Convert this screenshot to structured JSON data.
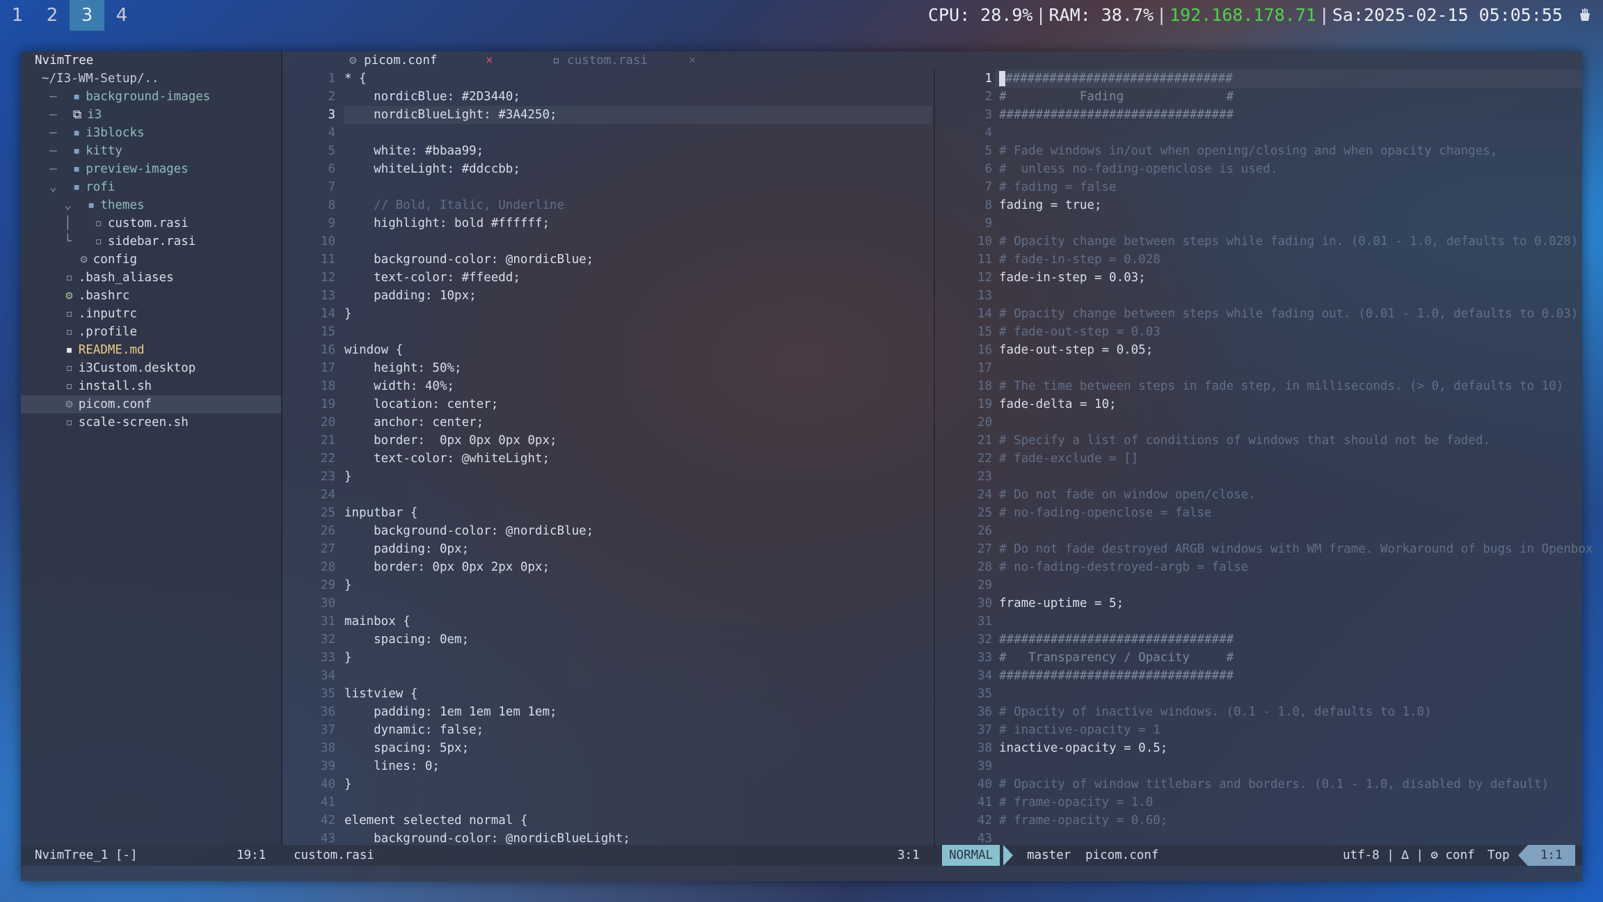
{
  "workspaces": [
    {
      "label": "1",
      "active": false
    },
    {
      "label": "2",
      "active": false
    },
    {
      "label": "3",
      "active": true
    },
    {
      "label": "4",
      "active": false
    }
  ],
  "status": {
    "cpu": "CPU: 28.9%",
    "ram": "RAM: 38.7%",
    "ip": "192.168.178.71",
    "datetime": "Sa:2025-02-15 05:05:55",
    "ip_color": "#4fd24a"
  },
  "tree": {
    "title": "NvimTree",
    "root": "~/I3-WM-Setup/..",
    "items": [
      {
        "prefix": "  –  ",
        "icon": "folder-icon",
        "name": "background-images",
        "kind": "dir"
      },
      {
        "prefix": "  –  ",
        "icon": "i3-icon",
        "name": "i3",
        "kind": "dir"
      },
      {
        "prefix": "  –  ",
        "icon": "folder-icon",
        "name": "i3blocks",
        "kind": "dir"
      },
      {
        "prefix": "  –  ",
        "icon": "folder-icon",
        "name": "kitty",
        "kind": "dir"
      },
      {
        "prefix": "  –  ",
        "icon": "folder-icon",
        "name": "preview-images",
        "kind": "dir"
      },
      {
        "prefix": "  ⌄  ",
        "icon": "folder-open-icon",
        "name": "rofi",
        "kind": "dir"
      },
      {
        "prefix": "    ⌄  ",
        "icon": "folder-open-icon",
        "name": "themes",
        "kind": "dir"
      },
      {
        "prefix": "    │   ",
        "icon": "file-icon",
        "name": "custom.rasi",
        "kind": "file"
      },
      {
        "prefix": "    └   ",
        "icon": "file-icon",
        "name": "sidebar.rasi",
        "kind": "file"
      },
      {
        "prefix": "      ",
        "icon": "gear-icon",
        "name": "config",
        "kind": "file"
      },
      {
        "prefix": "    ",
        "icon": "file-icon",
        "name": ".bash_aliases",
        "kind": "file"
      },
      {
        "prefix": "    ",
        "icon": "gear-icon",
        "name": ".bashrc",
        "kind": "file"
      },
      {
        "prefix": "    ",
        "icon": "file-icon",
        "name": ".inputrc",
        "kind": "file"
      },
      {
        "prefix": "    ",
        "icon": "file-icon",
        "name": ".profile",
        "kind": "file"
      },
      {
        "prefix": "    ",
        "icon": "markdown-icon",
        "name": "README.md",
        "kind": "md"
      },
      {
        "prefix": "    ",
        "icon": "desktop-icon",
        "name": "i3Custom.desktop",
        "kind": "file"
      },
      {
        "prefix": "    ",
        "icon": "shell-icon",
        "name": "install.sh",
        "kind": "file"
      },
      {
        "prefix": "    ",
        "icon": "gear-icon",
        "name": "picom.conf",
        "kind": "file",
        "selected": true
      },
      {
        "prefix": "    ",
        "icon": "shell-icon",
        "name": "scale-screen.sh",
        "kind": "file"
      }
    ]
  },
  "tabs": [
    {
      "icon": "gear-icon",
      "label": "picom.conf",
      "close": "×",
      "active": true
    },
    {
      "icon": "file-icon",
      "label": "custom.rasi",
      "close": "×",
      "active": false
    }
  ],
  "left_editor": {
    "current_line": 3,
    "lines": [
      "* {",
      "    nordicBlue: #2D3440;",
      "    nordicBlueLight: #3A4250;",
      "",
      "    white: #bbaa99;",
      "    whiteLight: #ddccbb;",
      "",
      "    // Bold, Italic, Underline",
      "    highlight: bold #ffffff;",
      "",
      "    background-color: @nordicBlue;",
      "    text-color: #ffeedd;",
      "    padding: 10px;",
      "}",
      "",
      "window {",
      "    height: 50%;",
      "    width: 40%;",
      "    location: center;",
      "    anchor: center;",
      "    border:  0px 0px 0px 0px;",
      "    text-color: @whiteLight;",
      "}",
      "",
      "inputbar {",
      "    background-color: @nordicBlue;",
      "    padding: 0px;",
      "    border: 0px 0px 2px 0px;",
      "}",
      "",
      "mainbox {",
      "    spacing: 0em;",
      "}",
      "",
      "listview {",
      "    padding: 1em 1em 1em 1em;",
      "    dynamic: false;",
      "    spacing: 5px;",
      "    lines: 0;",
      "}",
      "",
      "element selected normal {",
      "    background-color: @nordicBlueLight;"
    ]
  },
  "right_editor": {
    "current_line": 1,
    "lines": [
      "################################",
      "#          Fading              #",
      "################################",
      "",
      "# Fade windows in/out when opening/closing and when opacity changes,",
      "#  unless no-fading-openclose is used.",
      "# fading = false",
      "fading = true;",
      "",
      "# Opacity change between steps while fading in. (0.01 - 1.0, defaults to 0.028)",
      "# fade-in-step = 0.028",
      "fade-in-step = 0.03;",
      "",
      "# Opacity change between steps while fading out. (0.01 - 1.0, defaults to 0.03)",
      "# fade-out-step = 0.03",
      "fade-out-step = 0.05;",
      "",
      "# The time between steps in fade step, in milliseconds. (> 0, defaults to 10)",
      "fade-delta = 10;",
      "",
      "# Specify a list of conditions of windows that should not be faded.",
      "# fade-exclude = []",
      "",
      "# Do not fade on window open/close.",
      "# no-fading-openclose = false",
      "",
      "# Do not fade destroyed ARGB windows with WM frame. Workaround of bugs in Openbox",
      "# no-fading-destroyed-argb = false",
      "",
      "frame-uptime = 5;",
      "",
      "################################",
      "#   Transparency / Opacity     #",
      "################################",
      "",
      "# Opacity of inactive windows. (0.1 - 1.0, defaults to 1.0)",
      "# inactive-opacity = 1",
      "inactive-opacity = 0.5;",
      "",
      "# Opacity of window titlebars and borders. (0.1 - 1.0, disabled by default)",
      "# frame-opacity = 1.0",
      "# frame-opacity = 0.60;",
      ""
    ]
  },
  "statusline": {
    "tree_name": "NvimTree_1 [-]",
    "tree_pos": "19:1",
    "left_file": "custom.rasi",
    "left_pos": "3:1",
    "mode": "NORMAL",
    "branch_icon": "",
    "branch": "master",
    "file": "picom.conf",
    "encoding": "utf-8 | ∆ | ⚙ conf",
    "scroll": "Top",
    "pos": "1:1"
  }
}
